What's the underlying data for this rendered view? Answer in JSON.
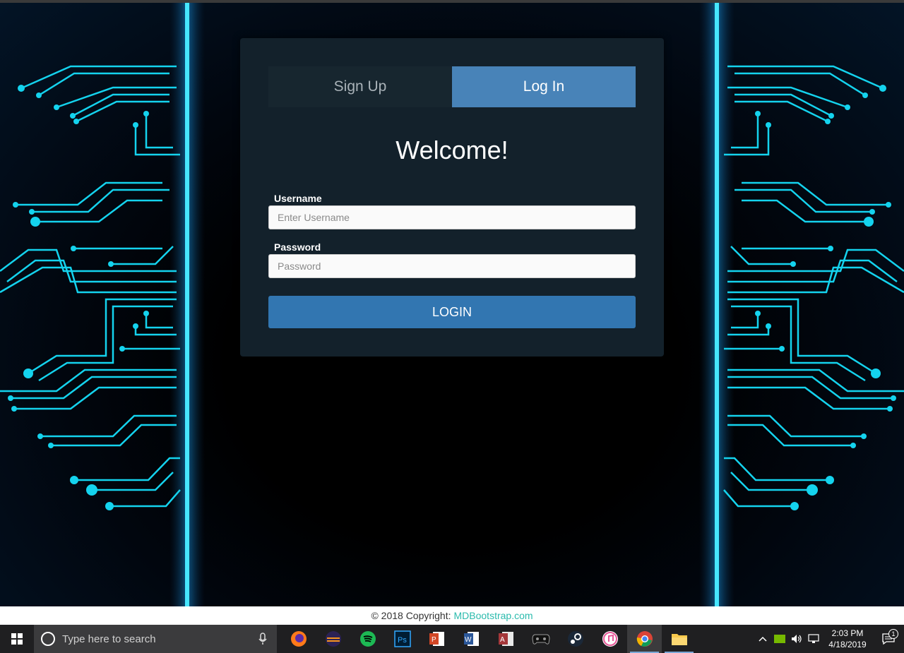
{
  "tabs": {
    "signup": "Sign Up",
    "login": "Log In"
  },
  "welcome": "Welcome!",
  "form": {
    "username_label": "Username",
    "username_placeholder": "Enter Username",
    "password_label": "Password",
    "password_placeholder": "Password",
    "submit_label": "LOGIN"
  },
  "footer": {
    "text": "© 2018 Copyright:",
    "link": "MDBootstrap.com"
  },
  "taskbar": {
    "search_placeholder": "Type here to search",
    "time": "2:03 PM",
    "date": "4/18/2019",
    "notification_count": "1",
    "apps": [
      "firefox",
      "eclipse",
      "spotify",
      "photoshop",
      "powerpoint",
      "word",
      "access",
      "game-controller",
      "steam",
      "itunes",
      "chrome",
      "file-explorer"
    ]
  },
  "colors": {
    "accent": "#3276b1",
    "active_tab": "#4883b8",
    "card": "#13212b",
    "circuit": "#12d6f0",
    "link": "#2bbbad"
  }
}
